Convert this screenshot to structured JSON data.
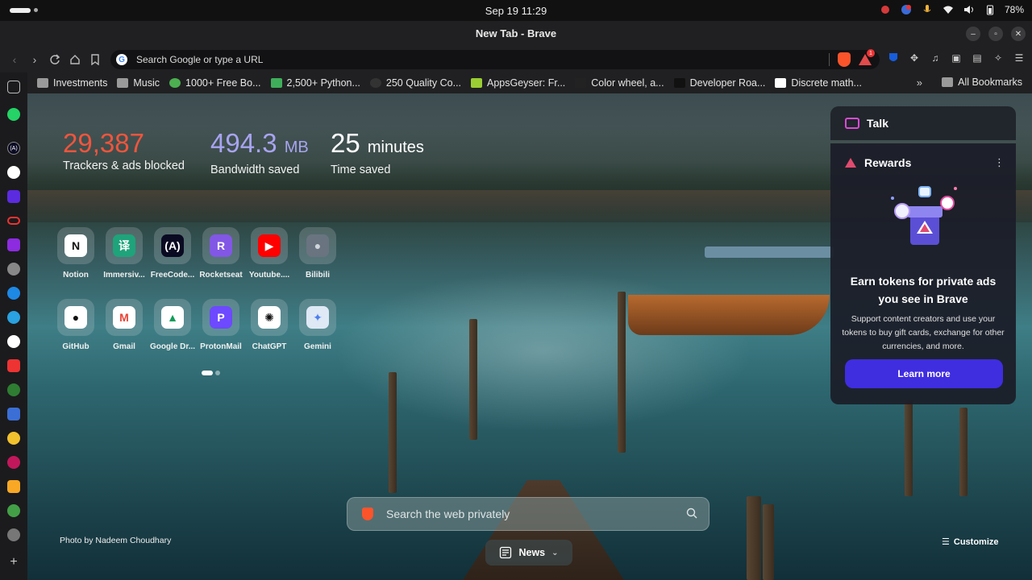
{
  "os": {
    "clock": "Sep 19  11:29",
    "battery": "78%"
  },
  "window": {
    "title": "New Tab - Brave"
  },
  "toolbar": {
    "url_placeholder": "Search Google or type a URL",
    "rewards_badge": "1"
  },
  "bookmarks": {
    "items": [
      {
        "label": "Investments",
        "icon": "folder-icon"
      },
      {
        "label": "Music",
        "icon": "folder-icon"
      },
      {
        "label": "1000+ Free Bo...",
        "icon": "leaf-icon"
      },
      {
        "label": "2,500+ Python...",
        "icon": "python-icon"
      },
      {
        "label": "250 Quality Co...",
        "icon": "circle-icon"
      },
      {
        "label": "AppsGeyser: Fr...",
        "icon": "appsgeyser-icon"
      },
      {
        "label": "Color wheel, a...",
        "icon": "color-wheel-icon"
      },
      {
        "label": "Developer Roa...",
        "icon": "roadmap-icon"
      },
      {
        "label": "Discrete math...",
        "icon": "w-icon"
      }
    ],
    "more": "»",
    "all_bookmarks": "All Bookmarks"
  },
  "stats": {
    "trackers_value": "29,387",
    "trackers_label": "Trackers & ads blocked",
    "bandwidth_value": "494.3",
    "bandwidth_unit": "MB",
    "bandwidth_label": "Bandwidth saved",
    "time_value": "25",
    "time_unit": "minutes",
    "time_label": "Time saved"
  },
  "top_sites": [
    {
      "label": "Notion",
      "glyph": "N",
      "bg": "#ffffff",
      "fg": "#111111"
    },
    {
      "label": "Immersiv...",
      "glyph": "译",
      "bg": "#1fa37a",
      "fg": "#ffffff"
    },
    {
      "label": "FreeCode...",
      "glyph": "(A)",
      "bg": "#0a0a23",
      "fg": "#ffffff"
    },
    {
      "label": "Rocketseat",
      "glyph": "R",
      "bg": "#8257e5",
      "fg": "#ffffff"
    },
    {
      "label": "Youtube....",
      "glyph": "▶",
      "bg": "#ff0000",
      "fg": "#ffffff"
    },
    {
      "label": "Bilibili",
      "glyph": "●",
      "bg": "#6a7480",
      "fg": "#cfd5da"
    },
    {
      "label": "GitHub",
      "glyph": "●",
      "bg": "#ffffff",
      "fg": "#111111"
    },
    {
      "label": "Gmail",
      "glyph": "M",
      "bg": "#ffffff",
      "fg": "#ea4335"
    },
    {
      "label": "Google Dr...",
      "glyph": "▲",
      "bg": "#ffffff",
      "fg": "#0f9d58"
    },
    {
      "label": "ProtonMail",
      "glyph": "P",
      "bg": "#6d4aff",
      "fg": "#ffffff"
    },
    {
      "label": "ChatGPT",
      "glyph": "✺",
      "bg": "#ffffff",
      "fg": "#111111"
    },
    {
      "label": "Gemini",
      "glyph": "✦",
      "bg": "#dfe8f5",
      "fg": "#4c7ff0"
    }
  ],
  "search": {
    "placeholder": "Search the web privately"
  },
  "footer": {
    "credit": "Photo by Nadeem Choudhary",
    "news": "News",
    "customize": "Customize"
  },
  "panel": {
    "talk": "Talk",
    "rewards": "Rewards",
    "title": "Earn tokens for private ads you see in Brave",
    "description": "Support content creators and use your tokens to buy gift cards, exchange for other currencies, and more.",
    "button": "Learn more"
  },
  "colors": {
    "trackers": "#f0553d",
    "bandwidth": "#a7a4f0",
    "accent": "#3f2de0"
  }
}
